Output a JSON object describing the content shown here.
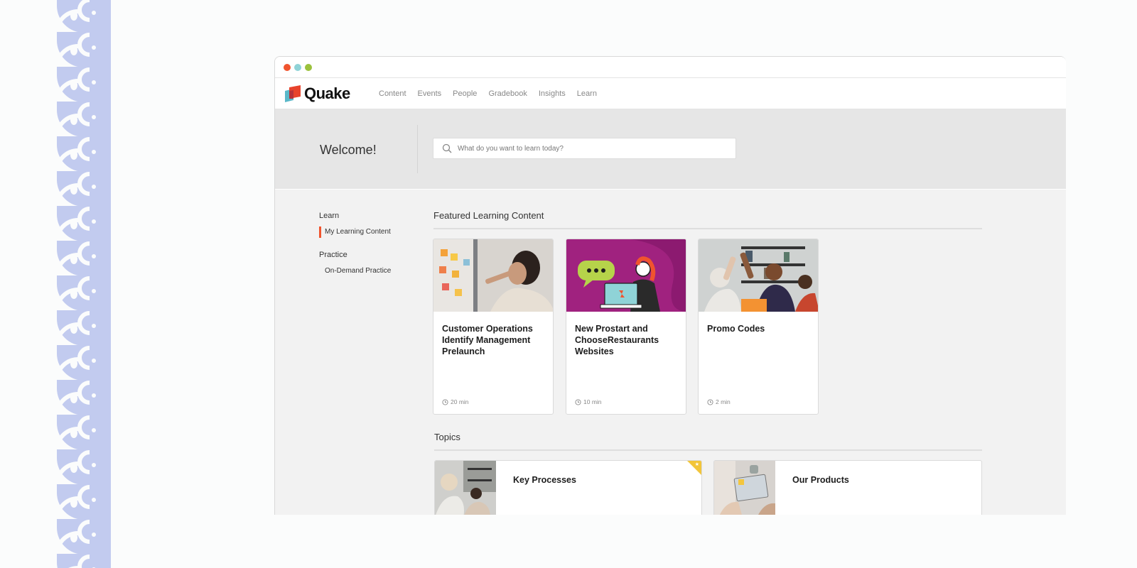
{
  "app": {
    "logo_text": "Quake",
    "accent_color": "#f0542e",
    "nav": [
      "Content",
      "Events",
      "People",
      "Gradebook",
      "Insights",
      "Learn"
    ]
  },
  "hero": {
    "welcome": "Welcome!",
    "search_placeholder": "What do you want to learn today?"
  },
  "sidebar": {
    "groups": [
      {
        "heading": "Learn",
        "items": [
          {
            "label": "My Learning Content",
            "active": true
          }
        ]
      },
      {
        "heading": "Practice",
        "items": [
          {
            "label": "On-Demand Practice",
            "active": false
          }
        ]
      }
    ]
  },
  "featured": {
    "title": "Featured Learning Content",
    "cards": [
      {
        "title": "Customer Operations Identify Management Prelaunch",
        "duration": "20 min",
        "image": "woman-writing-sticky-notes-photo"
      },
      {
        "title": "New Prostart and ChooseRestaurants Websites",
        "duration": "10 min",
        "image": "woman-laptop-chat-illustration"
      },
      {
        "title": "Promo Codes",
        "duration": "2 min",
        "image": "team-high-five-photo"
      }
    ]
  },
  "topics": {
    "title": "Topics",
    "items": [
      {
        "title": "Key Processes",
        "flagged": true,
        "image": "meeting-photo"
      },
      {
        "title": "Our Products",
        "flagged": false,
        "image": "laptop-hands-photo"
      }
    ]
  },
  "icons": {
    "search": "search-icon",
    "clock": "clock-icon",
    "star": "star-icon",
    "star_glyph": "★"
  }
}
